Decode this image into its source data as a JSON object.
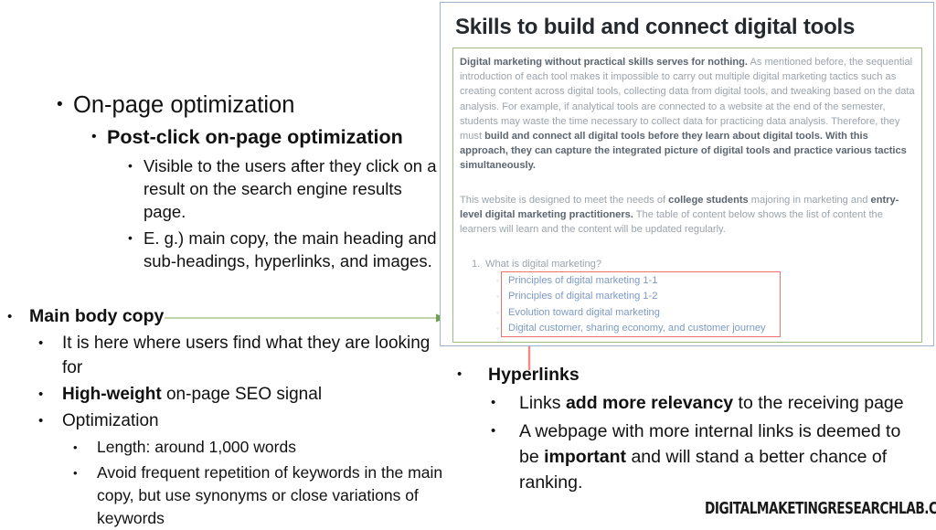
{
  "left_top": {
    "level1": "On-page optimization",
    "level2": "Post-click on-page optimization",
    "level3": [
      "Visible to the users after they click on a result on the search engine results page.",
      "E. g.) main copy, the main heading and sub-headings, hyperlinks, and images."
    ]
  },
  "left_bottom": {
    "heading": "Main body copy",
    "items": [
      {
        "pre": "It is here where users find what they are looking for",
        "bold": "",
        "post": ""
      },
      {
        "pre": "",
        "bold": "High-weight",
        "post": " on-page SEO signal"
      },
      {
        "pre": "Optimization",
        "bold": "",
        "post": ""
      }
    ],
    "sub_items": [
      "Length: around 1,000 words",
      "Avoid frequent repetition of keywords in the main copy, but use synonyms or close variations of keywords"
    ]
  },
  "right_bottom": {
    "heading": "Hyperlinks",
    "items": [
      {
        "pre": "Links ",
        "bold": "add more relevancy",
        "post": " to the receiving page"
      },
      {
        "pre": "A webpage with more internal links is deemed to be ",
        "bold": "important",
        "post": " and will stand a better chance of ranking."
      }
    ]
  },
  "screenshot": {
    "title": "Skills to build and connect digital tools",
    "paragraph1": {
      "bold_lead": "Digital marketing without practical skills serves for nothing.",
      "normal_mid": " As mentioned before, the sequential introduction of each tool makes it impossible to carry out multiple digital marketing tactics such as creating content across digital tools, collecting data from digital tools, and tweaking based on the data analysis. For example, if analytical tools are connected to a website at the end of the semester, students may waste the time necessary to collect data for practicing data analysis. Therefore, they must ",
      "bold_tail": "build and connect all digital tools before they learn about digital tools. With this approach, they can capture the integrated picture of digital tools and practice various tactics simultaneously."
    },
    "paragraph2": {
      "p1": "This website is designed to meet the needs of ",
      "b1": "college students",
      "p2": " majoring in marketing and ",
      "b2": "entry-level digital marketing practitioners.",
      "p3": " The table of content below shows the list of content the learners will learn and the content will be updated regularly."
    },
    "toc": {
      "number": "1.",
      "item": "What is digital marketing?",
      "links": [
        "Principles of digital marketing 1-1",
        "Principles of digital marketing 1-2",
        "Evolution toward digital marketing",
        "Digital customer, sharing economy, and customer journey"
      ]
    }
  },
  "footer": {
    "logo": "DIGITALMAKETINGRESEARCHLAB.COM"
  },
  "colors": {
    "panel_border": "#9fb4cc",
    "green_box": "#9dbb83",
    "red_box": "#f0716c",
    "link_blue": "#7d9ac4",
    "body_gray": "#9aa4ad",
    "bold_gray": "#5c6670",
    "green_arrow": "#a9c68f",
    "red_arrow": "#f0716c"
  },
  "bullets": {
    "disc": "•",
    "circle": "◦"
  }
}
